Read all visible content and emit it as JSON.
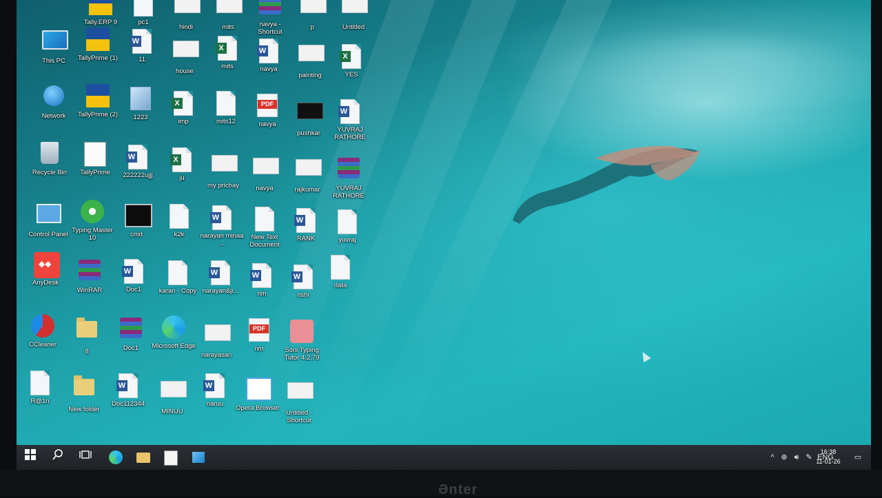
{
  "desktop": {
    "icons": [
      {
        "id": "tally-erp9",
        "label": "Tally.ERP 9",
        "type": "tally"
      },
      {
        "id": "pc1",
        "label": "pc1",
        "type": "doc"
      },
      {
        "id": "hindi",
        "label": "hindi",
        "type": "img"
      },
      {
        "id": "mits-top",
        "label": "mits",
        "type": "img"
      },
      {
        "id": "navya-shortcut",
        "label": "navya - Shortcut",
        "type": "rar"
      },
      {
        "id": "p",
        "label": "p",
        "type": "img"
      },
      {
        "id": "untitled",
        "label": "Untitled",
        "type": "img"
      },
      {
        "id": "this-pc",
        "label": "This PC",
        "type": "monitor"
      },
      {
        "id": "tallyprime-1",
        "label": "TallyPrime (1)",
        "type": "tally"
      },
      {
        "id": "11",
        "label": "11",
        "type": "word"
      },
      {
        "id": "house",
        "label": "house",
        "type": "img"
      },
      {
        "id": "mits",
        "label": "mits",
        "type": "excel"
      },
      {
        "id": "navya-word",
        "label": "navya",
        "type": "word"
      },
      {
        "id": "painting",
        "label": "painting",
        "type": "img"
      },
      {
        "id": "yes",
        "label": "YES",
        "type": "excel"
      },
      {
        "id": "network",
        "label": "Network",
        "type": "globe"
      },
      {
        "id": "tallyprime-2",
        "label": "TallyPrime (2)",
        "type": "tally"
      },
      {
        "id": "1223",
        "label": "1223",
        "type": "notepad"
      },
      {
        "id": "imp",
        "label": "imp",
        "type": "excel"
      },
      {
        "id": "mits12",
        "label": "mits12",
        "type": "doc"
      },
      {
        "id": "navya-pdf",
        "label": "navya",
        "type": "pdf"
      },
      {
        "id": "pushkar",
        "label": "pushkar",
        "type": "dark"
      },
      {
        "id": "yuvraj-rathore-word",
        "label": "YUVRAJ RATHORE",
        "type": "word"
      },
      {
        "id": "recycle-bin",
        "label": "Recycle Bin",
        "type": "bin"
      },
      {
        "id": "tallyprime",
        "label": "TallyPrime",
        "type": "tallyerp"
      },
      {
        "id": "222222ujjj",
        "label": "222222ujjj",
        "type": "word"
      },
      {
        "id": "ju",
        "label": "ju",
        "type": "excel"
      },
      {
        "id": "my-prichay",
        "label": "my prichay",
        "type": "img"
      },
      {
        "id": "navya-img",
        "label": "navya",
        "type": "img"
      },
      {
        "id": "rajkumar",
        "label": "rajkumar",
        "type": "img"
      },
      {
        "id": "yuvraj-rathore-rar",
        "label": "YUVRAJ RATHORE",
        "type": "rar"
      },
      {
        "id": "control-panel",
        "label": "Control Panel",
        "type": "cp"
      },
      {
        "id": "typing-master",
        "label": "Typing Master 10",
        "type": "typing"
      },
      {
        "id": "cmd",
        "label": "cmd",
        "type": "cmd"
      },
      {
        "id": "k2k",
        "label": "k2k",
        "type": "doc"
      },
      {
        "id": "narayan-minaa",
        "label": "narayan minaa ...",
        "type": "word"
      },
      {
        "id": "new-text-document",
        "label": "New Text Document",
        "type": "doc"
      },
      {
        "id": "rank",
        "label": "RANK",
        "type": "word"
      },
      {
        "id": "yuvraj",
        "label": "yuvraj",
        "type": "doc"
      },
      {
        "id": "anydesk",
        "label": "AnyDesk",
        "type": "anydesk"
      },
      {
        "id": "winrar",
        "label": "WinRAR",
        "type": "rar"
      },
      {
        "id": "doc1-word",
        "label": "Doc1",
        "type": "word"
      },
      {
        "id": "karan-copy",
        "label": "karan - Copy",
        "type": "doc"
      },
      {
        "id": "narayan-ji",
        "label": "narayan&ji...",
        "type": "word"
      },
      {
        "id": "nm-word",
        "label": "nm",
        "type": "word"
      },
      {
        "id": "rishi",
        "label": "rishi",
        "type": "word"
      },
      {
        "id": "data",
        "label": "data",
        "type": "doc"
      },
      {
        "id": "ccleaner",
        "label": "CCleaner",
        "type": "ccleaner"
      },
      {
        "id": "8",
        "label": "8",
        "type": "folder"
      },
      {
        "id": "doc1-rar",
        "label": "Doc1",
        "type": "rar"
      },
      {
        "id": "microsoft-edge",
        "label": "Microsoft Edge",
        "type": "edge"
      },
      {
        "id": "narayasan",
        "label": "narayasan",
        "type": "img"
      },
      {
        "id": "nm-pdf",
        "label": "nm",
        "type": "pdf"
      },
      {
        "id": "soni-typing",
        "label": "Soni Typing Tutor 4.2.79",
        "type": "soni"
      },
      {
        "id": "r1n",
        "label": "R@1n",
        "type": "doc"
      },
      {
        "id": "new-folder",
        "label": "New folder",
        "type": "folder"
      },
      {
        "id": "doc112344",
        "label": "Doc112344",
        "type": "word"
      },
      {
        "id": "minuu",
        "label": "MINUU",
        "type": "img"
      },
      {
        "id": "naruu",
        "label": "naruu",
        "type": "word"
      },
      {
        "id": "opera-browser",
        "label": "Opera Browser",
        "type": "opera"
      },
      {
        "id": "untitled-shortcut",
        "label": "Untitled - Shortcut",
        "type": "img"
      }
    ]
  },
  "taskbar": {
    "start_icon": "windows-start-icon",
    "search_icon": "search-icon",
    "task_view_icon": "task-view-icon",
    "pinned": [
      "edge-icon",
      "file-explorer-icon",
      "tally-icon",
      "app-icon"
    ],
    "tray": {
      "chevron": "^",
      "language": "ENG",
      "time": "16:38",
      "date": "11-01-26"
    }
  },
  "monitor_brand": "Ənter"
}
